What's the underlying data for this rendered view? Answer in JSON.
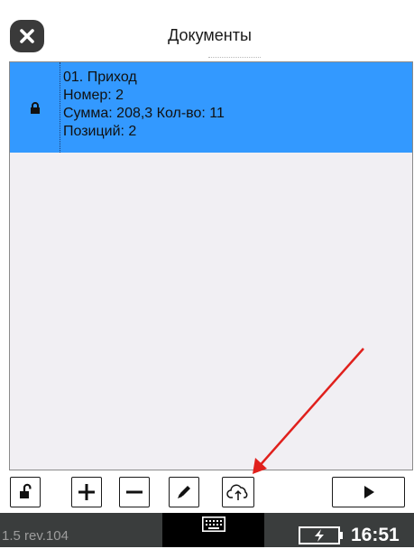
{
  "header": {
    "title": "Документы",
    "close_icon": "close-icon"
  },
  "documents": [
    {
      "lock_icon": "lock-icon",
      "lines": [
        "01. Приход",
        "Номер: 2",
        "Сумма: 208,3 Кол-во: 11",
        "Позиций: 2"
      ],
      "selected": true
    }
  ],
  "toolbar": {
    "buttons": [
      "unlock-icon",
      "plus-icon",
      "minus-icon",
      "pencil-icon",
      "cloud-upload-icon",
      "play-icon"
    ]
  },
  "status_bar": {
    "version": "1.5 rev.104",
    "keyboard_icon": "keyboard-icon",
    "battery_icon": "battery-charging-icon",
    "time": "16:51"
  },
  "colors": {
    "selection": "#3399ff",
    "status_bar": "#3a3d3d",
    "annotation_arrow": "#e0201c"
  }
}
